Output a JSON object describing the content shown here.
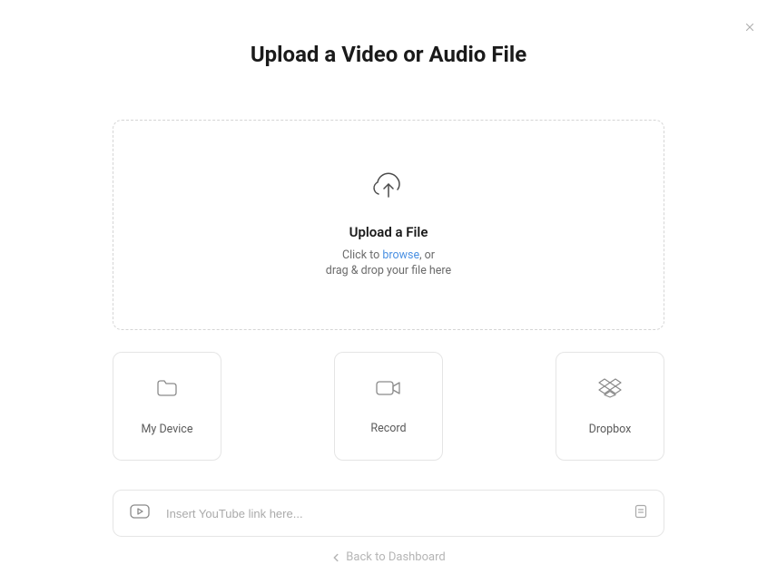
{
  "modal": {
    "title": "Upload a Video or Audio File"
  },
  "dropzone": {
    "title": "Upload a File",
    "subtitle_prefix": "Click to ",
    "subtitle_link": "browse",
    "subtitle_suffix": ", or",
    "subtitle_line2": "drag & drop your file here"
  },
  "options": {
    "device": "My Device",
    "record": "Record",
    "dropbox": "Dropbox"
  },
  "link_input": {
    "placeholder": "Insert YouTube link here..."
  },
  "footer": {
    "back_label": "Back to Dashboard"
  }
}
